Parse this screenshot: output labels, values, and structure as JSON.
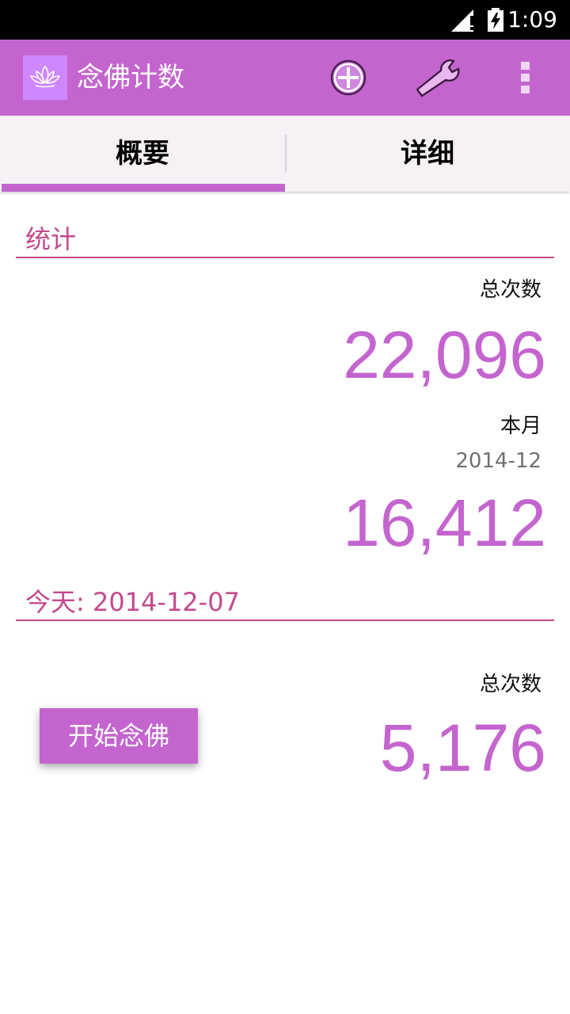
{
  "status_bar": {
    "time": "1:09",
    "signal_icon": "signal-icon",
    "battery_icon": "battery-charging-icon"
  },
  "action_bar": {
    "title": "念佛计数",
    "app_icon": "lotus-icon",
    "actions": [
      {
        "icon": "add-circle-icon"
      },
      {
        "icon": "wrench-icon"
      },
      {
        "icon": "overflow-menu-icon"
      }
    ],
    "background_color": "#c465cf"
  },
  "tabs": [
    {
      "label": "概要",
      "selected": true
    },
    {
      "label": "详细",
      "selected": false
    }
  ],
  "statistics": {
    "section_title": "统计",
    "total": {
      "label": "总次数",
      "value": "22,096"
    },
    "month": {
      "label": "本月",
      "date": "2014-12",
      "value": "16,412"
    }
  },
  "today": {
    "section_title": "今天: 2014-12-07",
    "total": {
      "label": "总次数",
      "value": "5,176"
    },
    "start_button": "开始念佛"
  },
  "colors": {
    "accent": "#c465cf",
    "section_title": "#c44a8c",
    "app_icon_background": "#cf87ff"
  }
}
